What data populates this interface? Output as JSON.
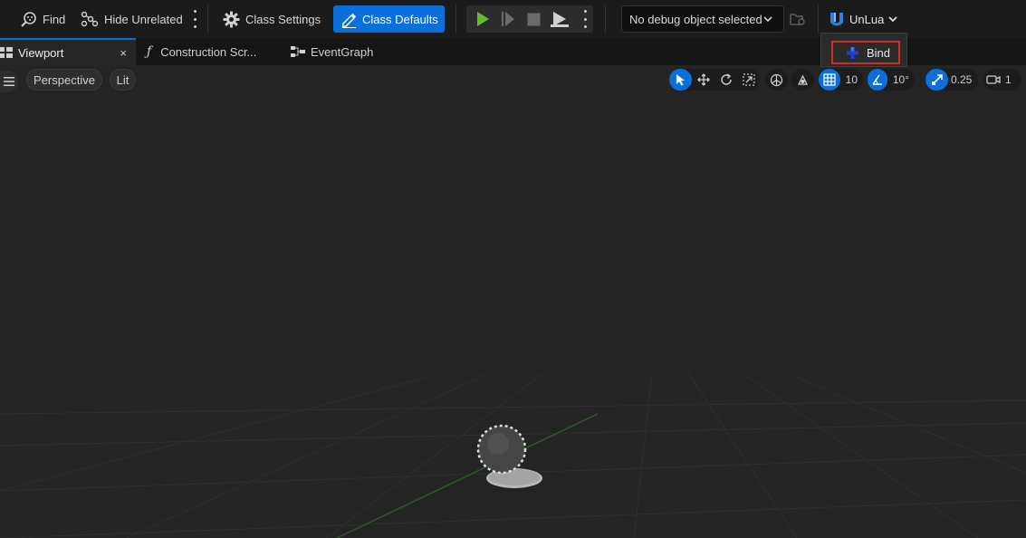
{
  "toolbar": {
    "find_label": "Find",
    "hide_unrelated_label": "Hide Unrelated",
    "class_settings_label": "Class Settings",
    "class_defaults_label": "Class Defaults",
    "debug_object_label": "No debug object selected",
    "unlua_label": "UnLua"
  },
  "unlua_menu": {
    "items": [
      {
        "label": "Bind",
        "icon": "bind-icon",
        "highlight_color": "#d12b2b"
      }
    ]
  },
  "tabs": [
    {
      "label": "Viewport",
      "icon": "viewport-icon",
      "active": true,
      "close_label": "×"
    },
    {
      "label": "Construction Scr...",
      "icon": "function-icon",
      "glyph": "ƒ"
    },
    {
      "label": "EventGraph",
      "icon": "graph-icon"
    }
  ],
  "viewport_toolbar": {
    "perspective_label": "Perspective",
    "lit_label": "Lit",
    "grid_snap_value": "10",
    "rotation_snap_value": "10°",
    "scale_snap_value": "0.25",
    "camera_speed_value": "1"
  },
  "icons": {
    "find": "find-icon",
    "hide_unrelated": "hide-unrelated-icon",
    "class_settings": "gear-icon",
    "class_defaults": "edit-pencil-icon",
    "play": "play-icon",
    "step": "step-icon",
    "stop": "stop-icon",
    "eject": "eject-icon",
    "debug_browse": "folder-icon",
    "unlua": "unlua-logo-icon",
    "viewport_menu": "hamburger-menu-icon",
    "select": "select-cursor-icon",
    "translate": "translate-icon",
    "rotate": "rotate-icon",
    "scale": "scale-icon",
    "local_world": "coordinate-space-icon",
    "surface_snap": "surface-snap-icon",
    "grid": "grid-snap-icon",
    "angle": "angle-snap-icon",
    "scale_snap": "scale-snap-icon",
    "camera": "camera-speed-icon"
  },
  "colors": {
    "accent": "#0a6fd8",
    "play_green": "#5fbf2e",
    "toolbar_bg": "#1b1b1b",
    "viewport_bg": "#242424",
    "highlight_border": "#d12b2b"
  }
}
